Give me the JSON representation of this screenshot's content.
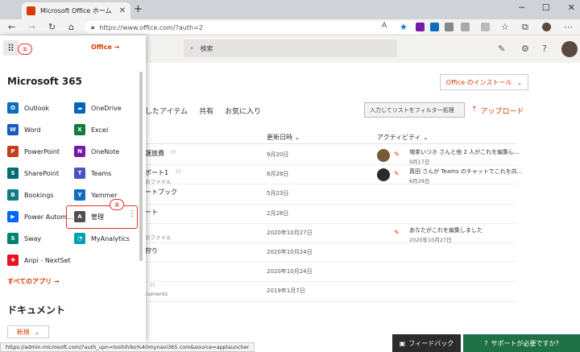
{
  "browser": {
    "tab_title": "Microsoft Office ホーム",
    "url": "https://www.office.com/?auth=2",
    "status_url": "https://admin.microsoft.com/?auth_upn=toshihiko%40mynavi365.com&source=applauncher"
  },
  "header": {
    "search_placeholder": "検索"
  },
  "launcher": {
    "annotation_1": "①",
    "annotation_2": "②",
    "office_link": "Office →",
    "title": "Microsoft 365",
    "apps_left": [
      {
        "label": "Outlook",
        "icon": "outlook-icon",
        "color": "#0f6cbd",
        "glyph": "O"
      },
      {
        "label": "Word",
        "icon": "word-icon",
        "color": "#185abd",
        "glyph": "W"
      },
      {
        "label": "PowerPoint",
        "icon": "powerpoint-icon",
        "color": "#c43e1c",
        "glyph": "P"
      },
      {
        "label": "SharePoint",
        "icon": "sharepoint-icon",
        "color": "#036c70",
        "glyph": "S"
      },
      {
        "label": "Bookings",
        "icon": "bookings-icon",
        "color": "#0f7b8a",
        "glyph": "B"
      },
      {
        "label": "Power Autom...",
        "icon": "power-automate-icon",
        "color": "#0066ff",
        "glyph": "▶"
      },
      {
        "label": "Sway",
        "icon": "sway-icon",
        "color": "#008272",
        "glyph": "S"
      },
      {
        "label": "Anpi - NextSet",
        "icon": "anpi-icon",
        "color": "#e81123",
        "glyph": "✚"
      }
    ],
    "apps_right": [
      {
        "label": "OneDrive",
        "icon": "onedrive-icon",
        "color": "#0364b8",
        "glyph": "☁"
      },
      {
        "label": "Excel",
        "icon": "excel-icon",
        "color": "#107c41",
        "glyph": "X"
      },
      {
        "label": "OneNote",
        "icon": "onenote-icon",
        "color": "#7719aa",
        "glyph": "N"
      },
      {
        "label": "Teams",
        "icon": "teams-icon",
        "color": "#4b53bc",
        "glyph": "T"
      },
      {
        "label": "Yammer",
        "icon": "yammer-icon",
        "color": "#106ebe",
        "glyph": "Y"
      },
      {
        "label": "管理",
        "icon": "admin-icon",
        "color": "#505050",
        "glyph": "A"
      },
      {
        "label": "MyAnalytics",
        "icon": "myanalytics-icon",
        "color": "#00a2ad",
        "glyph": "◔"
      }
    ],
    "all_apps": "すべてのアプリ →",
    "documents_title": "ドキュメント",
    "new_button": "新規"
  },
  "main": {
    "install_button": "Office のインストール",
    "tabs": [
      "したアイテム",
      "共有",
      "お気に入り"
    ],
    "filter_placeholder": "入力してリストをフィルター処理",
    "upload": "アップロード",
    "col_modified": "更新日時",
    "col_activity": "アクティビティ",
    "rows": [
      {
        "name": "護旅費",
        "sub": "",
        "date": "9月20日",
        "activity": "増茶いつき さんと他 2 人がこれを編集し...",
        "activity_date": "9月17日"
      },
      {
        "name": "ポート1",
        "sub": "のファイル",
        "date": "8月28日",
        "activity": "真田 さんが Teams のチャットでこれを共...",
        "activity_date": "8月28日"
      },
      {
        "name": "ートブック",
        "sub": "",
        "date": "5月23日",
        "activity": "",
        "activity_date": ""
      },
      {
        "name": "ート",
        "sub": "",
        "date": "2月28日",
        "activity": "",
        "activity_date": ""
      },
      {
        "name": "",
        "sub": "のファイル",
        "date": "2020年10月27日",
        "activity": "あなたがこれを編集しました",
        "activity_date": "2020年10月27日"
      },
      {
        "name": "狩り",
        "sub": "",
        "date": "2020年10月24日",
        "activity": "",
        "activity_date": ""
      },
      {
        "name": "",
        "sub": "",
        "date": "2020年10月24日",
        "activity": "",
        "activity_date": ""
      },
      {
        "name": "",
        "sub": "cuments",
        "date": "2019年1月7日",
        "activity": "",
        "activity_date": ""
      }
    ]
  },
  "footer": {
    "feedback": "フィードバック",
    "support": "サポートが必要ですか?"
  }
}
